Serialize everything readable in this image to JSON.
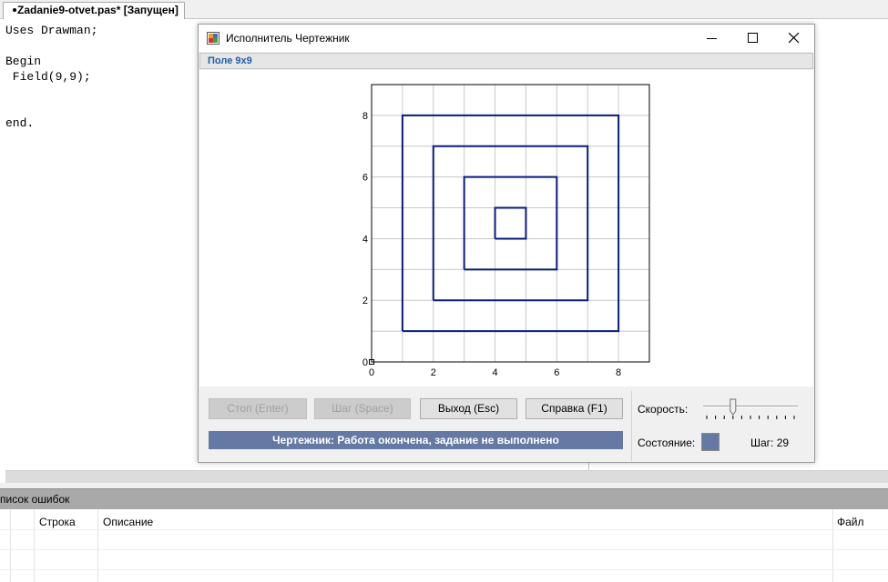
{
  "editor": {
    "tab_label": "Zadanie9-otvet.pas* [Запущен]",
    "code_lines": [
      "Uses Drawman;",
      "",
      "Begin",
      " Field(9,9);",
      "",
      "",
      "end."
    ]
  },
  "error_list": {
    "title": "писок ошибок",
    "columns": [
      "Строка",
      "Описание",
      "Файл"
    ]
  },
  "drawman_window": {
    "title": "Исполнитель Чертежник",
    "field_label": "Поле 9x9",
    "buttons": {
      "stop": "Стоп (Enter)",
      "step": "Шаг (Space)",
      "exit": "Выход (Esc)",
      "help": "Справка (F1)"
    },
    "status_message": "Чертежник: Работа окончена, задание не выполнено",
    "speed_label": "Скорость:",
    "state_label": "Состояние:",
    "step_count_label": "Шаг: 29",
    "state_color": "#647aa4",
    "speed_level": 0.3
  },
  "chart_data": {
    "type": "line",
    "title": "",
    "xlabel": "",
    "ylabel": "",
    "xlim": [
      0,
      9
    ],
    "ylim": [
      0,
      9
    ],
    "grid": true,
    "x_ticks": [
      "0",
      "2",
      "4",
      "6",
      "8"
    ],
    "y_ticks": [
      "8",
      "6",
      "4",
      "2",
      "0"
    ],
    "series": [
      {
        "points": [
          [
            1,
            1
          ],
          [
            8,
            1
          ],
          [
            8,
            8
          ],
          [
            1,
            8
          ],
          [
            1,
            1
          ]
        ]
      },
      {
        "points": [
          [
            2,
            2
          ],
          [
            7,
            2
          ],
          [
            7,
            7
          ],
          [
            2,
            7
          ],
          [
            2,
            2
          ]
        ]
      },
      {
        "points": [
          [
            3,
            3
          ],
          [
            6,
            3
          ],
          [
            6,
            6
          ],
          [
            3,
            6
          ],
          [
            3,
            3
          ]
        ]
      },
      {
        "points": [
          [
            4,
            4
          ],
          [
            5,
            4
          ],
          [
            5,
            5
          ],
          [
            4,
            5
          ],
          [
            4,
            4
          ]
        ]
      }
    ],
    "line_color": "#0a1a80"
  }
}
